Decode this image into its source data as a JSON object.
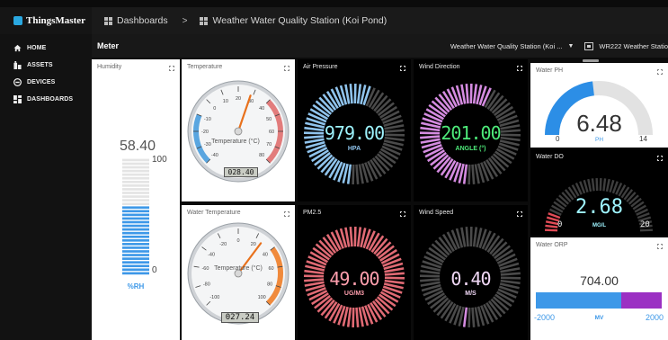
{
  "brand": {
    "name": "ThingsMaster"
  },
  "breadcrumb": {
    "dashboards": "Dashboards",
    "separator": ">",
    "current": "Weather Water Quality Station (Koi Pond)"
  },
  "sidebar": {
    "items": [
      {
        "label": "HOME",
        "icon": "home-icon"
      },
      {
        "label": "ASSETS",
        "icon": "assets-icon"
      },
      {
        "label": "DEVICES",
        "icon": "devices-icon"
      },
      {
        "label": "DASHBOARDS",
        "icon": "dashboards-icon"
      }
    ]
  },
  "toolbar": {
    "title": "Meter",
    "entity_select": "Weather Water Quality Station (Koi ...",
    "device_label": "WR222 Weather Statio"
  },
  "widgets": {
    "humidity": {
      "title": "Humidity",
      "value": "58.40",
      "max_label": "100",
      "min_label": "0",
      "unit": "%RH",
      "level": 0.584
    },
    "temperature": {
      "title": "Temperature",
      "dial_label": "Temperature (°C)",
      "readout": "028.40",
      "value": 28.4,
      "ticks": [
        "-40",
        "-30",
        "-20",
        "-10",
        "0",
        "10",
        "20",
        "30",
        "40",
        "50",
        "60",
        "70",
        "80"
      ]
    },
    "water_temperature": {
      "title": "Water Temperature",
      "dial_label": "Temperature (°C)",
      "readout": "027.24",
      "value": 27.24,
      "ticks": [
        "-100",
        "-80",
        "-60",
        "-40",
        "-20",
        "0",
        "20",
        "40",
        "60",
        "80",
        "100"
      ]
    },
    "air_pressure": {
      "title": "Air Pressure",
      "value": "979.00",
      "unit": "HPA",
      "level": 0.55
    },
    "wind_direction": {
      "title": "Wind Direction",
      "value": "201.00",
      "unit": "ANGLE (°)",
      "level": 0.56
    },
    "pm25": {
      "title": "PM2.5",
      "value": "49.00",
      "unit": "UG/M3",
      "level": 1.0
    },
    "wind_speed": {
      "title": "Wind Speed",
      "value": "0.40",
      "unit": "M/S",
      "level": 0.02
    },
    "water_ph": {
      "title": "Water PH",
      "value": "6.48",
      "min": "0",
      "max": "14",
      "unit": "PH",
      "level": 0.463
    },
    "water_do": {
      "title": "Water DO",
      "value": "2.68",
      "min": "0",
      "max": "20",
      "unit": "MG/L",
      "level": 0.134
    },
    "water_orp": {
      "title": "Water ORP",
      "value": "704.00",
      "min": "-2000",
      "max": "2000",
      "unit": "MV",
      "level": 0.676
    }
  },
  "colors": {
    "accent": "#2aa8e0",
    "pressure": "#8fc3ec",
    "wind_dir": "#d48be0",
    "pm": "#e06a74",
    "ph": "#2c8ee6",
    "do": "#e04b56",
    "orp_blue": "#3d98e8",
    "orp_purple": "#9b30c3",
    "digit_cyan": "#9ef4ff",
    "digit_green": "#4eea7a"
  }
}
